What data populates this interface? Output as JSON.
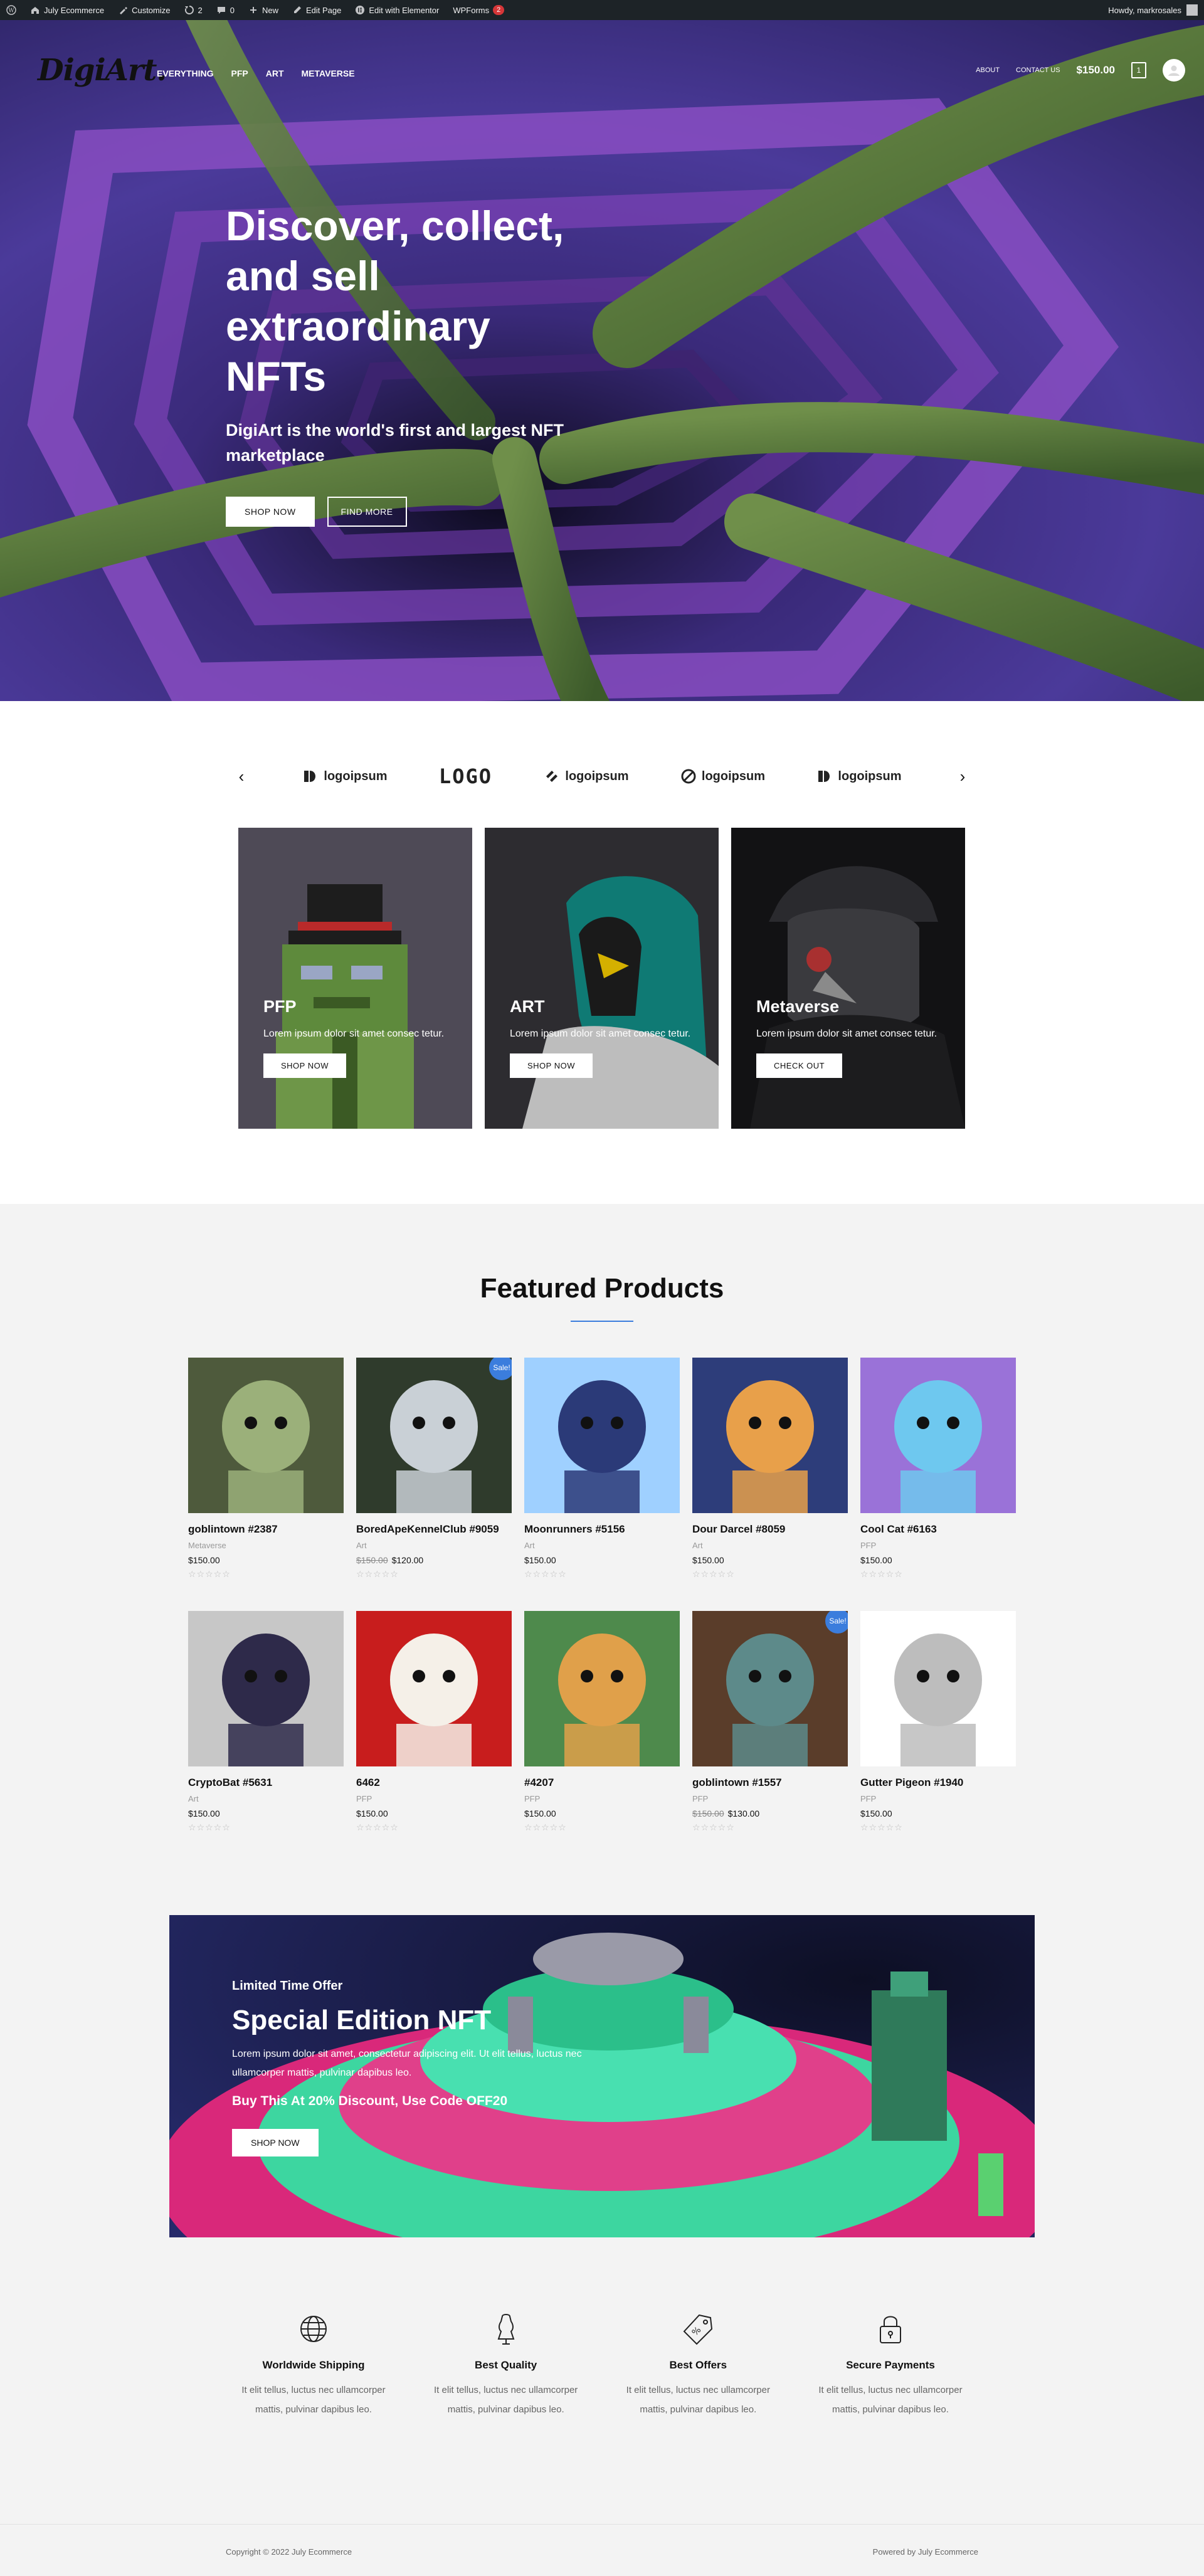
{
  "adminbar": {
    "wp_label": "",
    "site": "July Ecommerce",
    "customize": "Customize",
    "updates": "2",
    "comments": "0",
    "new": "New",
    "edit_page": "Edit Page",
    "elementor": "Edit with Elementor",
    "wpforms": "WPForms",
    "wpforms_count": "2",
    "howdy": "Howdy, markrosales"
  },
  "header": {
    "logo": "DigiArt.",
    "nav": [
      "EVERYTHING",
      "PFP",
      "ART",
      "METAVERSE"
    ],
    "about": "ABOUT",
    "contact": "CONTACT US",
    "cart_total": "$150.00",
    "cart_count": "1"
  },
  "hero": {
    "title": "Discover, collect, and sell extraordinary NFTs",
    "subtitle": "DigiArt is the world's first and largest NFT marketplace",
    "btn_shop": "SHOP NOW",
    "btn_find": "FIND MORE"
  },
  "partners": {
    "items": [
      "logoipsum",
      "LOGO",
      "logoipsum",
      "logoipsum",
      "logoipsum"
    ]
  },
  "categories": [
    {
      "title": "PFP",
      "desc": "Lorem ipsum dolor sit amet consec tetur.",
      "btn": "SHOP NOW"
    },
    {
      "title": "ART",
      "desc": "Lorem ipsum dolor sit amet consec tetur.",
      "btn": "SHOP NOW"
    },
    {
      "title": "Metaverse",
      "desc": "Lorem ipsum dolor sit amet consec tetur.",
      "btn": "CHECK OUT"
    }
  ],
  "featured": {
    "title": "Featured Products",
    "sale_label": "Sale!",
    "stars": "☆☆☆☆☆",
    "products": [
      {
        "name": "goblintown #2387",
        "cat": "Metaverse",
        "old": "",
        "price": "$150.00",
        "sale": false,
        "colors": {
          "bg": "#4e5a3c",
          "fg": "#9bb07a"
        }
      },
      {
        "name": "BoredApeKennelClub #9059",
        "cat": "Art",
        "old": "$150.00",
        "price": "$120.00",
        "sale": true,
        "colors": {
          "bg": "#2f3b2c",
          "fg": "#c9d0d6"
        }
      },
      {
        "name": "Moonrunners #5156",
        "cat": "Art",
        "old": "",
        "price": "$150.00",
        "sale": false,
        "colors": {
          "bg": "#9fd0ff",
          "fg": "#2b3a78"
        }
      },
      {
        "name": "Dour Darcel #8059",
        "cat": "Art",
        "old": "",
        "price": "$150.00",
        "sale": false,
        "colors": {
          "bg": "#2d3d7a",
          "fg": "#e8a04a"
        }
      },
      {
        "name": "Cool Cat #6163",
        "cat": "PFP",
        "old": "",
        "price": "$150.00",
        "sale": false,
        "colors": {
          "bg": "#9a72d8",
          "fg": "#6ec8ef"
        }
      },
      {
        "name": "CryptoBat #5631",
        "cat": "Art",
        "old": "",
        "price": "$150.00",
        "sale": false,
        "colors": {
          "bg": "#c7c7c7",
          "fg": "#2e2a4a"
        }
      },
      {
        "name": "6462",
        "cat": "PFP",
        "old": "",
        "price": "$150.00",
        "sale": false,
        "colors": {
          "bg": "#c81d1d",
          "fg": "#f5f0e8"
        }
      },
      {
        "name": "#4207",
        "cat": "PFP",
        "old": "",
        "price": "$150.00",
        "sale": false,
        "colors": {
          "bg": "#4e8a4c",
          "fg": "#e0a04a"
        }
      },
      {
        "name": "goblintown #1557",
        "cat": "PFP",
        "old": "$150.00",
        "price": "$130.00",
        "sale": true,
        "colors": {
          "bg": "#5a3d2a",
          "fg": "#5d8a8a"
        }
      },
      {
        "name": "Gutter Pigeon #1940",
        "cat": "PFP",
        "old": "",
        "price": "$150.00",
        "sale": false,
        "colors": {
          "bg": "#ffffff",
          "fg": "#bdbdbd"
        }
      }
    ]
  },
  "promo": {
    "kicker": "Limited Time Offer",
    "title": "Special Edition NFT",
    "desc": "Lorem ipsum dolor sit amet, consectetur adipiscing elit. Ut elit tellus, luctus nec ullamcorper mattis, pulvinar dapibus leo.",
    "code": "Buy This At 20% Discount, Use Code OFF20",
    "btn": "SHOP NOW"
  },
  "features": [
    {
      "icon": "globe-icon",
      "title": "Worldwide Shipping",
      "desc": "It elit tellus, luctus nec ullamcorper mattis, pulvinar dapibus leo."
    },
    {
      "icon": "dress-form-icon",
      "title": "Best Quality",
      "desc": "It elit tellus, luctus nec ullamcorper mattis, pulvinar dapibus leo."
    },
    {
      "icon": "price-tag-icon",
      "title": "Best Offers",
      "desc": "It elit tellus, luctus nec ullamcorper mattis, pulvinar dapibus leo."
    },
    {
      "icon": "padlock-icon",
      "title": "Secure Payments",
      "desc": "It elit tellus, luctus nec ullamcorper mattis, pulvinar dapibus leo."
    }
  ],
  "footer": {
    "copyright": "Copyright © 2022 July Ecommerce",
    "powered": "Powered by July Ecommerce"
  }
}
